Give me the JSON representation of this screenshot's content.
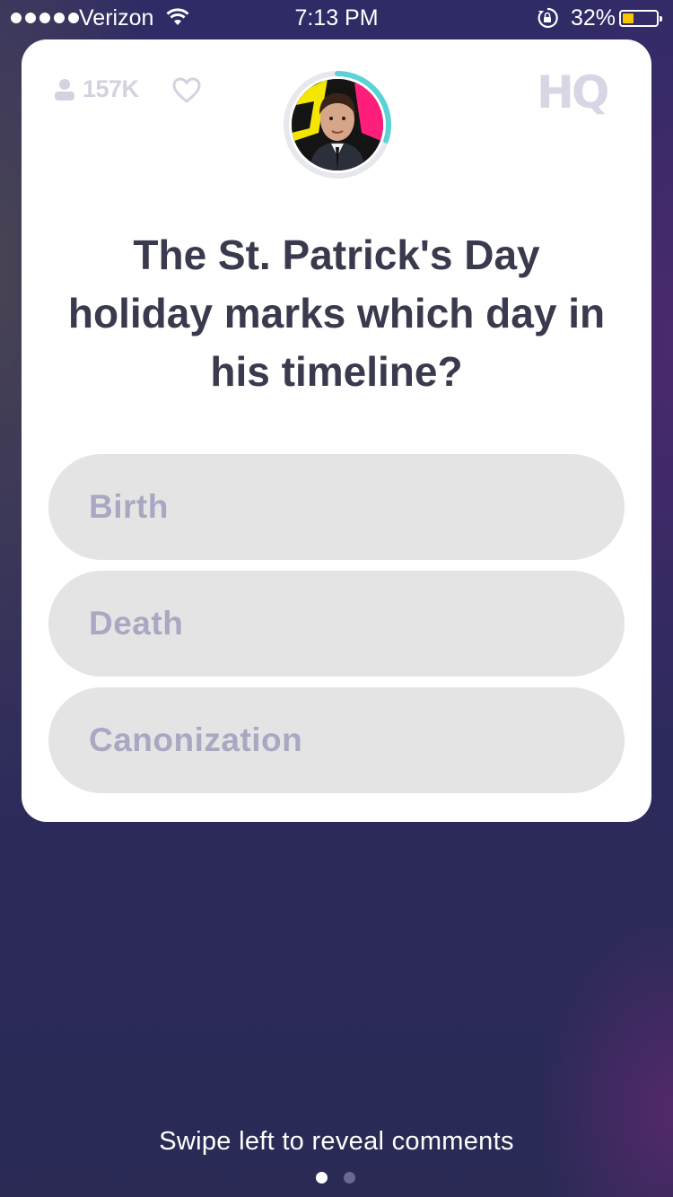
{
  "status_bar": {
    "carrier": "Verizon",
    "time": "7:13 PM",
    "battery_percent": "32%",
    "battery_level": 0.32,
    "signal_bars": 5,
    "icons": [
      "wifi-icon",
      "orientation-lock-icon",
      "battery-icon"
    ]
  },
  "game": {
    "viewer_count": "157K",
    "logo_text": "HQ",
    "timer_progress": 0.3,
    "colors": {
      "timer_ring": "#5ad2d6",
      "answer_bg": "#e4e4e4",
      "answer_text": "#a9a8c2",
      "question_text": "#3a3a4e"
    },
    "question": "The St. Patrick's Day holiday marks which day in his timeline?",
    "answers": [
      "Birth",
      "Death",
      "Canonization"
    ]
  },
  "footer": {
    "hint": "Swipe left to reveal comments",
    "pages": 2,
    "active_page": 1
  }
}
